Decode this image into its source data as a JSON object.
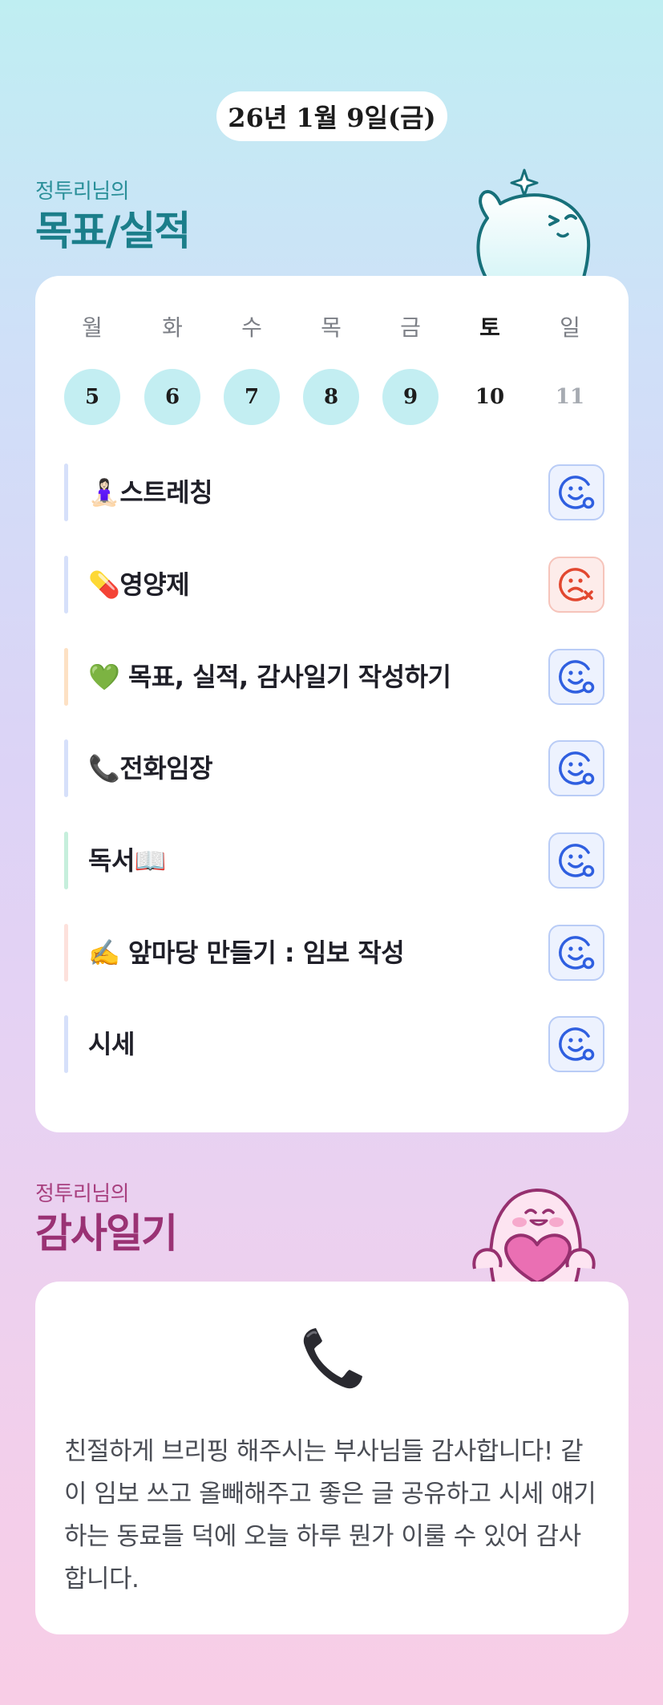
{
  "date_label": "26년 1월 9일(금)",
  "goals_section": {
    "subtitle": "정투리님의",
    "title": "목표/실적"
  },
  "week": [
    {
      "day": "월",
      "num": "5",
      "state": "done"
    },
    {
      "day": "화",
      "num": "6",
      "state": "done"
    },
    {
      "day": "수",
      "num": "7",
      "state": "done"
    },
    {
      "day": "목",
      "num": "8",
      "state": "done"
    },
    {
      "day": "금",
      "num": "9",
      "state": "done"
    },
    {
      "day": "토",
      "num": "10",
      "state": "active"
    },
    {
      "day": "일",
      "num": "11",
      "state": "future"
    }
  ],
  "goals": [
    {
      "label": "🧘🏻‍♀️스트레칭",
      "status": "success",
      "bar_color": "#d6e0fa"
    },
    {
      "label": "💊영양제",
      "status": "fail",
      "bar_color": "#d6e0fa"
    },
    {
      "label": "💚 목표, 실적, 감사일기 작성하기",
      "status": "success",
      "bar_color": "#fde1c4"
    },
    {
      "label": "📞전화임장",
      "status": "success",
      "bar_color": "#d6e0fa"
    },
    {
      "label": "독서📖",
      "status": "success",
      "bar_color": "#c6efdc"
    },
    {
      "label": "✍️ 앞마당 만들기 : 임보 작성",
      "status": "success",
      "bar_color": "#fde1dc"
    },
    {
      "label": "시세",
      "status": "success",
      "bar_color": "#d6e0fa"
    }
  ],
  "diary_section": {
    "subtitle": "정투리님의",
    "title": "감사일기"
  },
  "diary": {
    "icon": "telephone-receiver-icon",
    "text": "친절하게 브리핑 해주시는 부사님들 감사합니다! 같이 임보 쓰고 올빼해주고 좋은 글 공유하고 시세 얘기하는 동료들 덕에 오늘 하루 뭔가 이룰 수 있어 감사합니다."
  },
  "colors": {
    "success_icon": "#2f5fe0",
    "fail_icon": "#e2472f",
    "goals_title": "#1b7e8a",
    "diary_title": "#9a3274"
  }
}
